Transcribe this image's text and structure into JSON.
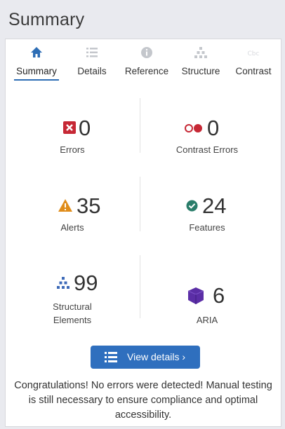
{
  "panel": {
    "title": "Summary"
  },
  "tabs": [
    {
      "label": "Summary",
      "icon": "home-icon",
      "active": true
    },
    {
      "label": "Details",
      "icon": "list-icon",
      "active": false
    },
    {
      "label": "Reference",
      "icon": "info-icon",
      "active": false
    },
    {
      "label": "Structure",
      "icon": "hierarchy-icon",
      "active": false
    },
    {
      "label": "Contrast",
      "icon": "contrast-icon",
      "active": false
    }
  ],
  "stats": {
    "errors": {
      "value": "0",
      "label": "Errors",
      "icon": "error-x-icon",
      "color": "#c62835"
    },
    "contrast_errors": {
      "value": "0",
      "label": "Contrast Errors",
      "icon": "contrast-circles-icon",
      "color": "#c62835"
    },
    "alerts": {
      "value": "35",
      "label": "Alerts",
      "icon": "warning-triangle-icon",
      "color": "#e08d1b"
    },
    "features": {
      "value": "24",
      "label": "Features",
      "icon": "check-circle-icon",
      "color": "#2a7d6a"
    },
    "structural": {
      "value": "99",
      "label_line1": "Structural",
      "label_line2": "Elements",
      "icon": "hierarchy-icon",
      "color": "#3d6ab8"
    },
    "aria": {
      "value": "6",
      "label": "ARIA",
      "icon": "aria-cube-icon",
      "color": "#5b2ea6"
    }
  },
  "view_details": {
    "label": "View details ›",
    "icon": "list-icon"
  },
  "message": "Congratulations! No errors were detected! Manual testing is still necessary to ensure compliance and optimal accessibility."
}
